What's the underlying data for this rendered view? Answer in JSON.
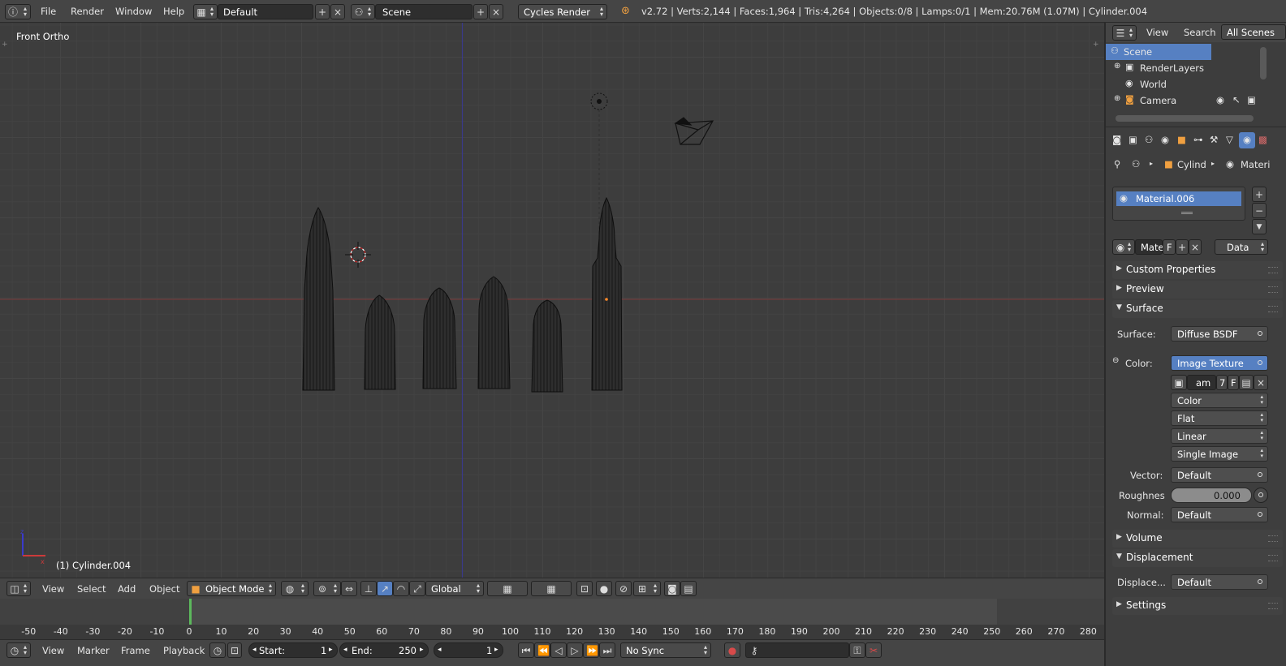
{
  "topbar": {
    "menu": [
      "File",
      "Render",
      "Window",
      "Help"
    ],
    "layout": "Default",
    "scene": "Scene",
    "engine": "Cycles Render",
    "stats": "v2.72 | Verts:2,144 | Faces:1,964 | Tris:4,264 | Objects:0/8 | Lamps:0/1 | Mem:20.76M (1.07M) | Cylinder.004"
  },
  "viewport": {
    "title": "Front Ortho",
    "object_label": "(1) Cylinder.004",
    "header": {
      "menu": [
        "View",
        "Select",
        "Add",
        "Object"
      ],
      "mode": "Object Mode",
      "orientation": "Global"
    }
  },
  "timeline": {
    "ticks": [
      "-50",
      "-40",
      "-30",
      "-20",
      "-10",
      "0",
      "10",
      "20",
      "30",
      "40",
      "50",
      "60",
      "70",
      "80",
      "90",
      "100",
      "110",
      "120",
      "130",
      "140",
      "150",
      "160",
      "170",
      "180",
      "190",
      "200",
      "210",
      "220",
      "230",
      "240",
      "250",
      "260",
      "270",
      "280"
    ],
    "current_frame": 1,
    "header": {
      "menu": [
        "View",
        "Marker",
        "Frame",
        "Playback"
      ],
      "start_label": "Start:",
      "start": "1",
      "end_label": "End:",
      "end": "250",
      "frame": "1",
      "sync": "No Sync"
    }
  },
  "outliner": {
    "menu": [
      "View",
      "Search"
    ],
    "filter": "All Scenes",
    "rows": [
      "Scene",
      "RenderLayers",
      "World",
      "Camera"
    ]
  },
  "properties": {
    "breadcrumb": [
      "Cylind",
      "Materi"
    ],
    "material_slot": "Material.006",
    "datablock": "Mate",
    "datablock_flag": "F",
    "link": "Data",
    "panels": {
      "custom_properties": "Custom Properties",
      "preview": "Preview",
      "surface": "Surface",
      "volume": "Volume",
      "displacement": "Displacement",
      "settings": "Settings"
    },
    "surface": {
      "surface_label": "Surface:",
      "surface_value": "Diffuse BSDF",
      "color_label": "Color:",
      "color_value": "Image Texture",
      "image_name": "am",
      "image_users": "7",
      "image_flag": "F",
      "color_space": "Color",
      "projection": "Flat",
      "interpolation": "Linear",
      "source": "Single Image",
      "vector_label": "Vector:",
      "vector_value": "Default",
      "roughness_label": "Roughnes",
      "roughness_value": "0.000",
      "normal_label": "Normal:",
      "normal_value": "Default"
    },
    "displacement": {
      "label": "Displace...",
      "value": "Default"
    }
  },
  "colors": {
    "selection_blue": "#5680c2",
    "x_axis": "#8a3b3b",
    "z_axis": "#3b3b9a"
  }
}
